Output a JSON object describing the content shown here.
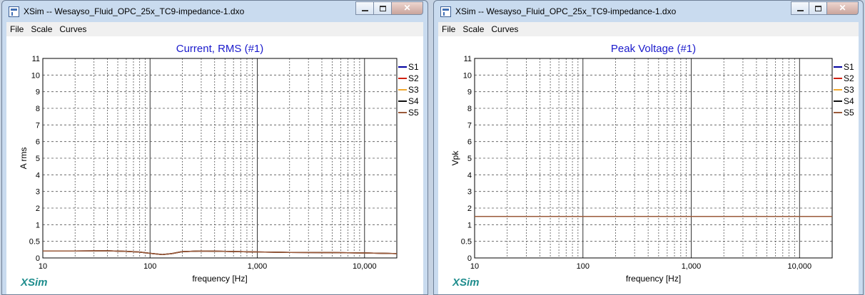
{
  "windows": [
    {
      "title": "XSim -- Wesayso_Fluid_OPC_25x_TC9-impedance-1.dxo",
      "menu": [
        "File",
        "Scale",
        "Curves"
      ],
      "active": false,
      "logo": "XSim",
      "chart_data": {
        "type": "line",
        "title": "Current, RMS (#1)",
        "xlabel": "frequency [Hz]",
        "ylabel": "A rms",
        "xscale": "log",
        "xlim": [
          10,
          20000
        ],
        "ylim": [
          0,
          12
        ],
        "xtick_values": [
          10,
          100,
          1000,
          10000
        ],
        "xtick_labels": [
          "10",
          "100",
          "1,000",
          "10,000"
        ],
        "ytick_values": [
          0,
          1,
          2,
          3,
          4,
          5,
          6,
          7,
          8,
          9,
          10,
          11,
          12
        ],
        "ytick_labels": [
          "0",
          "0.5",
          "1",
          "2",
          "3",
          "4",
          "5",
          "6",
          "7",
          "8",
          "9",
          "10",
          "11",
          "12"
        ],
        "grid": true,
        "legend_position": "right",
        "series": [
          {
            "name": "S1",
            "color": "#0000a0",
            "x": [
              10,
              20,
              40,
              60,
              80,
              100,
              130,
              160,
              200,
              300,
              500,
              1000,
              2000,
              5000,
              10000,
              20000
            ],
            "y": [
              0.42,
              0.42,
              0.43,
              0.4,
              0.35,
              0.28,
              0.2,
              0.26,
              0.38,
              0.42,
              0.4,
              0.36,
              0.33,
              0.32,
              0.3,
              0.26
            ]
          },
          {
            "name": "S2",
            "color": "#d02010",
            "x": [
              10,
              20,
              40,
              60,
              80,
              100,
              130,
              160,
              200,
              300,
              500,
              1000,
              2000,
              5000,
              10000,
              20000
            ],
            "y": [
              0.42,
              0.42,
              0.43,
              0.4,
              0.35,
              0.28,
              0.2,
              0.26,
              0.38,
              0.42,
              0.4,
              0.36,
              0.33,
              0.32,
              0.3,
              0.26
            ]
          },
          {
            "name": "S3",
            "color": "#f0a830",
            "x": [
              10,
              20,
              40,
              60,
              80,
              100,
              130,
              160,
              200,
              300,
              500,
              1000,
              2000,
              5000,
              10000,
              20000
            ],
            "y": [
              0.42,
              0.42,
              0.43,
              0.4,
              0.35,
              0.28,
              0.2,
              0.26,
              0.38,
              0.42,
              0.4,
              0.36,
              0.33,
              0.32,
              0.3,
              0.26
            ]
          },
          {
            "name": "S4",
            "color": "#101010",
            "x": [
              10,
              20,
              40,
              60,
              80,
              100,
              130,
              160,
              200,
              300,
              500,
              1000,
              2000,
              5000,
              10000,
              20000
            ],
            "y": [
              0.42,
              0.42,
              0.43,
              0.4,
              0.35,
              0.28,
              0.2,
              0.26,
              0.38,
              0.42,
              0.4,
              0.36,
              0.33,
              0.32,
              0.3,
              0.26
            ]
          },
          {
            "name": "S5",
            "color": "#9a5a3a",
            "x": [
              10,
              20,
              40,
              60,
              80,
              100,
              130,
              160,
              200,
              300,
              500,
              1000,
              2000,
              5000,
              10000,
              20000
            ],
            "y": [
              0.42,
              0.42,
              0.43,
              0.4,
              0.35,
              0.28,
              0.2,
              0.26,
              0.38,
              0.42,
              0.4,
              0.36,
              0.33,
              0.32,
              0.3,
              0.26
            ]
          }
        ]
      }
    },
    {
      "title": "XSim -- Wesayso_Fluid_OPC_25x_TC9-impedance-1.dxo",
      "menu": [
        "File",
        "Scale",
        "Curves"
      ],
      "active": true,
      "logo": "XSim",
      "chart_data": {
        "type": "line",
        "title": "Peak Voltage (#1)",
        "xlabel": "frequency [Hz]",
        "ylabel": "Vpk",
        "xscale": "log",
        "xlim": [
          10,
          20000
        ],
        "ylim": [
          0,
          12
        ],
        "xtick_values": [
          10,
          100,
          1000,
          10000
        ],
        "xtick_labels": [
          "10",
          "100",
          "1,000",
          "10,000"
        ],
        "ytick_values": [
          0,
          1,
          2,
          3,
          4,
          5,
          6,
          7,
          8,
          9,
          10,
          11,
          12
        ],
        "ytick_labels": [
          "0",
          "0.5",
          "1",
          "2",
          "3",
          "4",
          "5",
          "6",
          "7",
          "8",
          "9",
          "10",
          "11",
          "12"
        ],
        "grid": true,
        "legend_position": "right",
        "series": [
          {
            "name": "S1",
            "color": "#0000a0",
            "x": [
              10,
              20000
            ],
            "y": [
              2.5,
              2.5
            ]
          },
          {
            "name": "S2",
            "color": "#d02010",
            "x": [
              10,
              20000
            ],
            "y": [
              2.5,
              2.5
            ]
          },
          {
            "name": "S3",
            "color": "#f0a830",
            "x": [
              10,
              20000
            ],
            "y": [
              2.5,
              2.5
            ]
          },
          {
            "name": "S4",
            "color": "#101010",
            "x": [
              10,
              20000
            ],
            "y": [
              2.5,
              2.5
            ]
          },
          {
            "name": "S5",
            "color": "#9a5a3a",
            "x": [
              10,
              20000
            ],
            "y": [
              2.5,
              2.5
            ]
          }
        ]
      }
    }
  ]
}
